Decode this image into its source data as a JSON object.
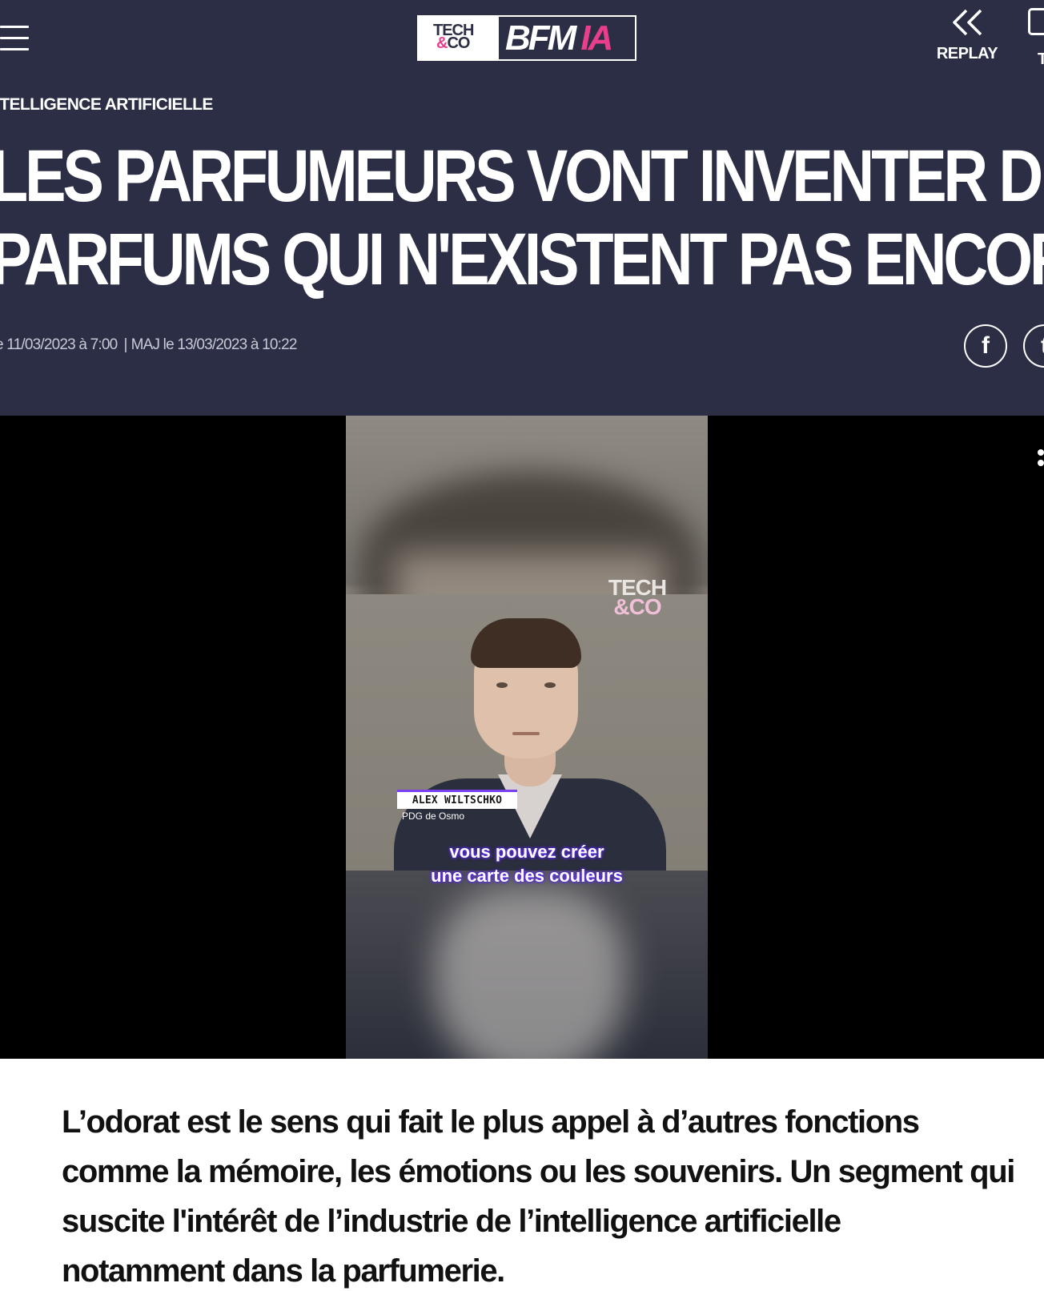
{
  "header": {
    "logo": {
      "tech_co_line1": "TECH",
      "tech_co_amp": "&",
      "tech_co_line2": "CO",
      "bfm": "BFM",
      "ia": "IA"
    },
    "replay_label": "REPLAY",
    "tv_label": "T",
    "colors": {
      "background": "#2b2e44",
      "accent": "#e83e8c"
    }
  },
  "article": {
    "category": "ITELLIGENCE ARTIFICIELLE",
    "title_lines": [
      "LES PARFUMEURS VONT INVENTER DES",
      "PARFUMS QUI N'EXISTENT PAS ENCORE"
    ],
    "published": "e 11/03/2023 à 7:00",
    "separator": "|",
    "updated": "MAJ le 13/03/2023 à 10:22",
    "share": {
      "facebook": "f",
      "twitter": "t"
    },
    "lead_lines": [
      "L’odorat est le sens qui fait le plus appel à d’autres fonctions",
      "comme la mémoire, les émotions ou les souvenirs. Un segment qui",
      "suscite l'intérêt de l’industrie de l’intelligence artificielle",
      "notamment dans la parfumerie."
    ]
  },
  "video": {
    "watermark_line1": "TECH",
    "watermark_amp": "&",
    "watermark_line2": "CO",
    "speaker_name": "ALEX WILTSCHKO",
    "speaker_role": "PDG de Osmo",
    "subtitle_line1": "vous pouvez créer",
    "subtitle_line2": "une carte des couleurs"
  }
}
